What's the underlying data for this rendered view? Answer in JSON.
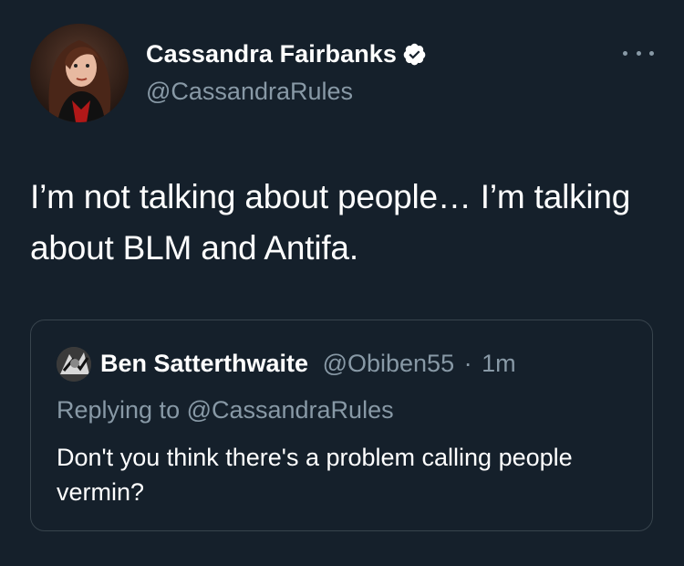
{
  "author": {
    "display_name": "Cassandra Fairbanks",
    "handle": "@CassandraRules",
    "verified_icon": "verified-badge-icon"
  },
  "tweet": {
    "text": "I’m not talking about people… I’m talking about BLM and Antifa."
  },
  "quoted_tweet": {
    "display_name": "Ben Satterthwaite",
    "handle": "@Obiben55",
    "separator": "·",
    "time": "1m",
    "replying_to": "Replying to @CassandraRules",
    "text": "Don't you think there's a problem calling people vermin?"
  },
  "colors": {
    "background": "#15202b",
    "secondary_text": "#8899a6",
    "border": "#38444d",
    "text": "#ffffff"
  }
}
